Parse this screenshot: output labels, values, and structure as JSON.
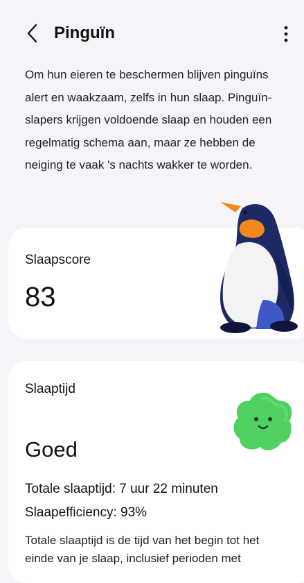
{
  "header": {
    "title": "Pinguïn",
    "back_icon": "chevron-left-icon",
    "more_icon": "more-vertical-icon"
  },
  "description": "Om hun eieren te beschermen blijven pinguïns alert en waakzaam, zelfs in hun slaap. Pinguïn-slapers krijgen voldoende slaap en houden een regelmatig schema aan, maar ze hebben de neiging te vaak 's nachts wakker te worden.",
  "score_card": {
    "label": "Slaapscore",
    "value": "83",
    "illustration": "penguin-illustration"
  },
  "time_card": {
    "label": "Slaaptijd",
    "rating": "Goed",
    "total_sleep": "Totale slaaptijd: 7 uur 22 minuten",
    "efficiency": "Slaapefficiency: 93%",
    "explanation": "Totale slaaptijd is de tijd van het begin tot het einde van je slaap, inclusief perioden met",
    "illustration": "green-mascot-illustration"
  },
  "colors": {
    "background": "#f5f4f9",
    "card": "#ffffff",
    "penguin_body": "#1e2a66",
    "penguin_beak": "#f18a1c",
    "mascot_green": "#4fd061"
  }
}
